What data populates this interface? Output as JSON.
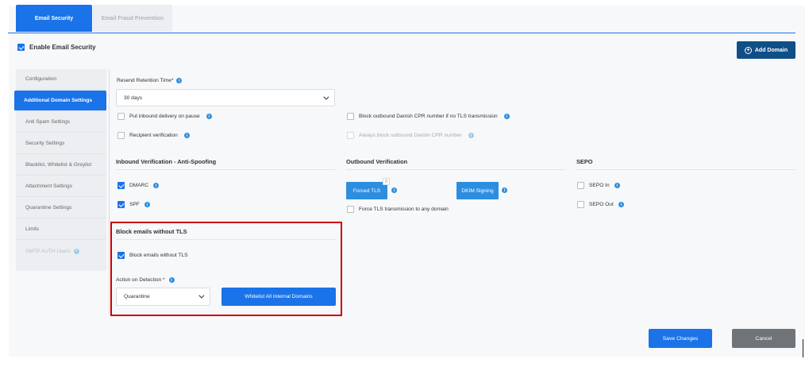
{
  "tabs": [
    {
      "label": "Email Security",
      "active": true
    },
    {
      "label": "Email Fraud Prevention",
      "active": false
    }
  ],
  "enable_email_security": {
    "label": "Enable Email Security",
    "checked": true
  },
  "add_domain_label": "Add Domain",
  "sidebar": {
    "items": [
      {
        "label": "Configuration"
      },
      {
        "label": "Additional Domain Settings",
        "active": true
      },
      {
        "label": "Anti Spam Settings"
      },
      {
        "label": "Security Settings"
      },
      {
        "label": "Blacklist, Whitelist & Greylist"
      },
      {
        "label": "Attachment Settings"
      },
      {
        "label": "Quarantine Settings"
      },
      {
        "label": "Limits"
      },
      {
        "label": "SMTP AUTH Users",
        "disabled": true
      }
    ]
  },
  "resend_retention": {
    "label": "Resend Retention Time*",
    "value": "30 days"
  },
  "options": {
    "put_inbound_on_pause": {
      "label": "Put inbound delivery on pause",
      "checked": false
    },
    "recipient_verification": {
      "label": "Recipient verification",
      "checked": false
    },
    "block_outbound_cpr": {
      "label": "Block outbound Danish CPR number if no TLS transmission",
      "checked": false
    },
    "always_block_cpr": {
      "label": "Always block outbound Danish CPR number",
      "checked": false,
      "disabled": true
    }
  },
  "inbound_verification": {
    "title": "Inbound Verification - Anti-Spoofing",
    "dmarc": {
      "label": "DMARC",
      "checked": true
    },
    "spf": {
      "label": "SPF",
      "checked": true
    }
  },
  "outbound_verification": {
    "title": "Outbound Verification",
    "forced_tls_label": "Forced TLS",
    "forced_tls_badge": "0",
    "dkim_label": "DKIM Signing",
    "force_tls_any": {
      "label": "Force TLS transmission to any domain",
      "checked": false
    }
  },
  "sepo": {
    "title": "SEPO",
    "sepo_in": {
      "label": "SEPO In",
      "checked": false
    },
    "sepo_out": {
      "label": "SEPO Out",
      "checked": false
    }
  },
  "block_without_tls": {
    "title": "Block emails without TLS",
    "checkbox": {
      "label": "Block emails without TLS",
      "checked": true
    },
    "action_label": "Action on Detection *",
    "action_value": "Quarantine",
    "whitelist_button": "Whitelist All Internal Domains"
  },
  "footer": {
    "save_label": "Save Changes",
    "cancel_label": "Cancel"
  },
  "colors": {
    "primary": "#1a73e8",
    "navy": "#104e87",
    "highlight": "#cc0000",
    "cancel": "#6f7478"
  },
  "icons": {
    "info": "info-icon",
    "check": "check-icon",
    "chevron": "chevron-down-icon",
    "add": "plus-circle-icon"
  }
}
